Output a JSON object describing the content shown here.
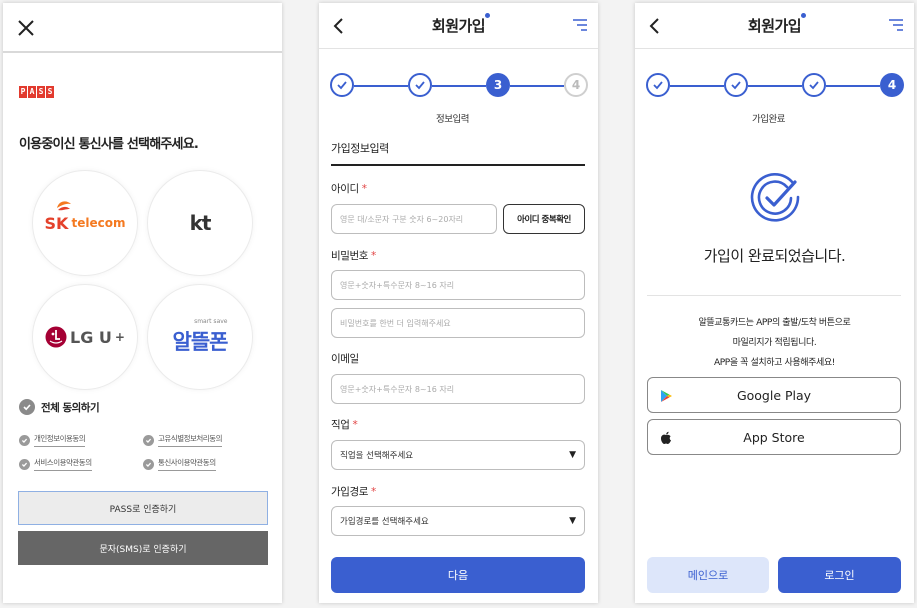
{
  "screen1": {
    "pass_logo": [
      "P",
      "A",
      "S",
      "S"
    ],
    "title": "이용중이신 통신사를 선택해주세요.",
    "carriers": [
      {
        "sk": "SK",
        "sub": "telecom"
      },
      {
        "name": "kt"
      },
      {
        "name": "LG U",
        "plus": "+"
      },
      {
        "small": "smart save",
        "name": "알뜰폰"
      }
    ],
    "agree_all": "전체 동의하기",
    "agreements": [
      "개인정보이용동의",
      "고유식별정보처리동의",
      "서비스이용약관동의",
      "통신사이용약관동의"
    ],
    "pass_button": "PASS로 인증하기",
    "sms_button": "문자(SMS)로 인증하기"
  },
  "screen2": {
    "header_title": "회원가입",
    "steps": [
      "",
      "",
      "3",
      "4"
    ],
    "step_label": "정보입력",
    "section_title": "가입정보입력",
    "id_label": "아이디",
    "id_placeholder": "영문 대/소문자 구분 숫자 6~20자리",
    "dup_button": "아이디 중복확인",
    "pw_label": "비밀번호",
    "pw_placeholder": "영문+숫자+특수문자 8~16 자리",
    "pw_confirm_placeholder": "비밀번호를 한번 더 입력해주세요",
    "email_label": "이메일",
    "email_placeholder": "영문+숫자+특수문자 8~16 자리",
    "job_label": "직업",
    "job_selected": "직업을 선택해주세요",
    "route_label": "가입경로",
    "route_selected": "가입경로를 선택해주세요",
    "required_mark": "*",
    "select_arrow": "▼",
    "next_button": "다음"
  },
  "screen3": {
    "header_title": "회원가입",
    "steps": [
      "",
      "",
      "",
      "4"
    ],
    "step_label": "가입완료",
    "done_message": "가입이 완료되었습니다.",
    "info_lines": [
      "알뜰교통카드는 APP의 출발/도착 버튼으로",
      "마일리지가 적립됩니다.",
      "APP을 꼭 설치하고 사용해주세요!"
    ],
    "google_play": "Google Play",
    "app_store": "App Store",
    "main_button": "메인으로",
    "login_button": "로그인"
  },
  "colors": {
    "primary": "#3a5fd0",
    "pass_red": "#e23a2e",
    "sk_red": "#e4412b",
    "kt_dark": "#333333",
    "lg_red": "#a50034",
    "alddl_blue": "#3a5fd0",
    "required": "#e24545"
  }
}
